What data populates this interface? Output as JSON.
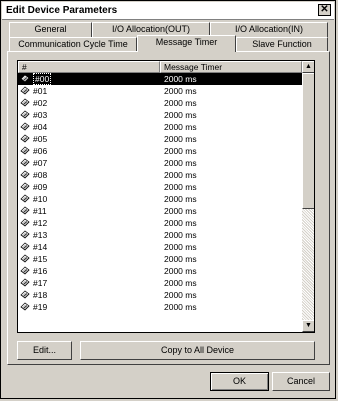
{
  "window": {
    "title": "Edit Device Parameters",
    "close_glyph": "✕"
  },
  "tabs": [
    {
      "label": "General"
    },
    {
      "label": "I/O Allocation(OUT)"
    },
    {
      "label": "I/O Allocation(IN)"
    },
    {
      "label": "Communication Cycle Time"
    },
    {
      "label": "Message Timer"
    },
    {
      "label": "Slave Function"
    }
  ],
  "table": {
    "columns": [
      "#",
      "Message Timer"
    ],
    "rows": [
      {
        "id": "#00",
        "value": "2000 ms"
      },
      {
        "id": "#01",
        "value": "2000 ms"
      },
      {
        "id": "#02",
        "value": "2000 ms"
      },
      {
        "id": "#03",
        "value": "2000 ms"
      },
      {
        "id": "#04",
        "value": "2000 ms"
      },
      {
        "id": "#05",
        "value": "2000 ms"
      },
      {
        "id": "#06",
        "value": "2000 ms"
      },
      {
        "id": "#07",
        "value": "2000 ms"
      },
      {
        "id": "#08",
        "value": "2000 ms"
      },
      {
        "id": "#09",
        "value": "2000 ms"
      },
      {
        "id": "#10",
        "value": "2000 ms"
      },
      {
        "id": "#11",
        "value": "2000 ms"
      },
      {
        "id": "#12",
        "value": "2000 ms"
      },
      {
        "id": "#13",
        "value": "2000 ms"
      },
      {
        "id": "#14",
        "value": "2000 ms"
      },
      {
        "id": "#15",
        "value": "2000 ms"
      },
      {
        "id": "#16",
        "value": "2000 ms"
      },
      {
        "id": "#17",
        "value": "2000 ms"
      },
      {
        "id": "#18",
        "value": "2000 ms"
      },
      {
        "id": "#19",
        "value": "2000 ms"
      }
    ],
    "selected_row": "#00",
    "row_icon": "device-icon"
  },
  "scrollbar": {
    "up_glyph": "▲",
    "down_glyph": "▼"
  },
  "buttons": {
    "edit": "Edit...",
    "copy_all": "Copy to All Device",
    "ok": "OK",
    "cancel": "Cancel"
  }
}
